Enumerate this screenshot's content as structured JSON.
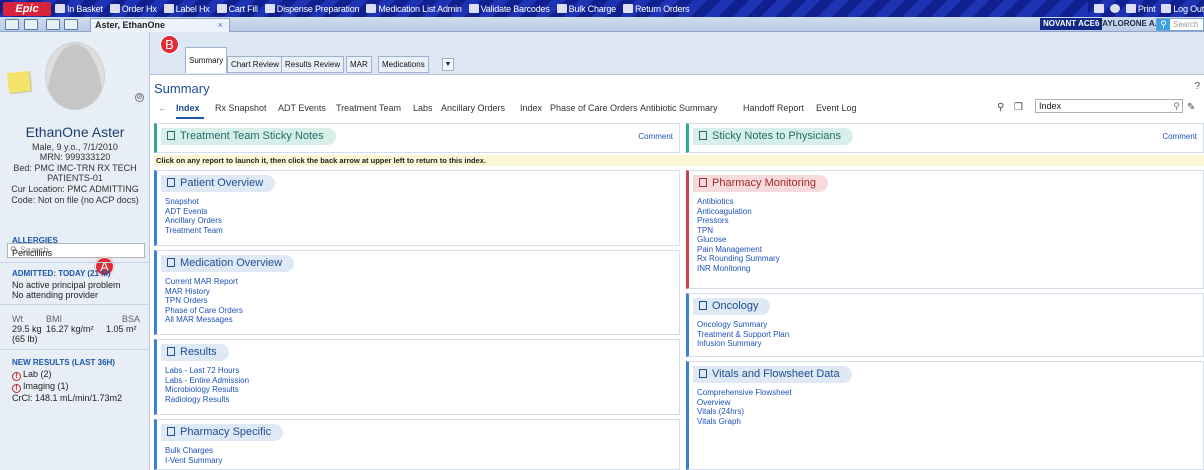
{
  "toolbar": {
    "epic_label": "Epic",
    "items": [
      "In Basket",
      "Order Hx",
      "Label Hx",
      "Cart Fill",
      "Dispense Preparation",
      "Medication List Admin",
      "Validate Barcodes",
      "Bulk Charge",
      "Return Orders"
    ],
    "print_label": "Print",
    "logout_label": "Log Out"
  },
  "workspace": {
    "patient_tab": "Aster, EthanOne",
    "org_badge": "NOVANT ACE6",
    "user_name": "TAYLORONE A.",
    "search_placeholder": "Search"
  },
  "patient": {
    "name": "EthanOne Aster",
    "demographics": "Male, 9 y.o., 7/1/2010",
    "mrn": "MRN: 999333120",
    "bed": "Bed: PMC IMC-TRN RX TECH PATIENTS-01",
    "location": "Cur Location: PMC ADMITTING",
    "code": "Code: Not on file (no ACP docs)",
    "search_placeholder": "Search",
    "marker": "A",
    "allergies_title": "ALLERGIES",
    "allergies": "Penicillins",
    "admitted_title": "ADMITTED: TODAY (21 M)",
    "admitted_lines": [
      "No active principal problem",
      "No attending provider"
    ],
    "vitals_labels": [
      "Wt",
      "BMI",
      "BSA"
    ],
    "vitals_values": [
      "29.5 kg",
      "16.27 kg/m²",
      "1.05 m²"
    ],
    "weight_lb": "(65 lb)",
    "results_title": "NEW RESULTS (LAST 36H)",
    "results": [
      "Lab (2)",
      "Imaging (1)"
    ],
    "crcl": "CrCl: 148.1 mL/min/1.73m2"
  },
  "activity_tabs": {
    "marker": "B",
    "tabs": [
      "Summary",
      "Chart Review",
      "Results Review",
      "MAR",
      "Medications"
    ],
    "active": "Summary"
  },
  "summary": {
    "title": "Summary",
    "subtabs": [
      "Index",
      "Rx Snapshot",
      "ADT Events",
      "Treatment Team",
      "Labs",
      "Ancillary Orders",
      "Index",
      "Phase of Care Orders",
      "Antibiotic Summary",
      "Handoff Report",
      "Event Log"
    ],
    "active_subtab": "Index",
    "index_search_value": "Index",
    "info_bar": "Click on any report to launch it, then click the back arrow at upper left to return to this index.",
    "comment_label": "Comment",
    "panels": {
      "treatment_team_sticky": {
        "title": "Treatment Team Sticky Notes"
      },
      "sticky_physicians": {
        "title": "Sticky Notes to Physicians"
      },
      "patient_overview": {
        "title": "Patient Overview",
        "links": [
          "Snapshot",
          "ADT Events",
          "Ancillary Orders",
          "Treatment Team"
        ]
      },
      "medication_overview": {
        "title": "Medication Overview",
        "links": [
          "Current MAR Report",
          "MAR History",
          "TPN Orders",
          "Phase of Care Orders",
          "All MAR Messages"
        ]
      },
      "results": {
        "title": "Results",
        "links": [
          "Labs - Last 72 Hours",
          "Labs - Entire Admission",
          "Microbiology Results",
          "Radiology Results"
        ]
      },
      "pharmacy_specific": {
        "title": "Pharmacy Specific",
        "links": [
          "Bulk Charges",
          "I-Vent Summary"
        ]
      },
      "pharmacy_monitoring": {
        "title": "Pharmacy Monitoring",
        "links": [
          "Antibiotics",
          "Anticoagulation",
          "Pressors",
          "TPN",
          "Glucose",
          "Pain Management",
          "Rx Rounding Summary",
          "INR Monitoring"
        ]
      },
      "oncology": {
        "title": "Oncology",
        "links": [
          "Oncology Summary",
          "Treatment & Support Plan",
          "Infusion Summary"
        ]
      },
      "vitals": {
        "title": "Vitals and Flowsheet Data",
        "links": [
          "Comprehensive Flowsheet",
          "Overview",
          "Vitals (24hrs)",
          "Vitals Graph"
        ]
      }
    }
  }
}
